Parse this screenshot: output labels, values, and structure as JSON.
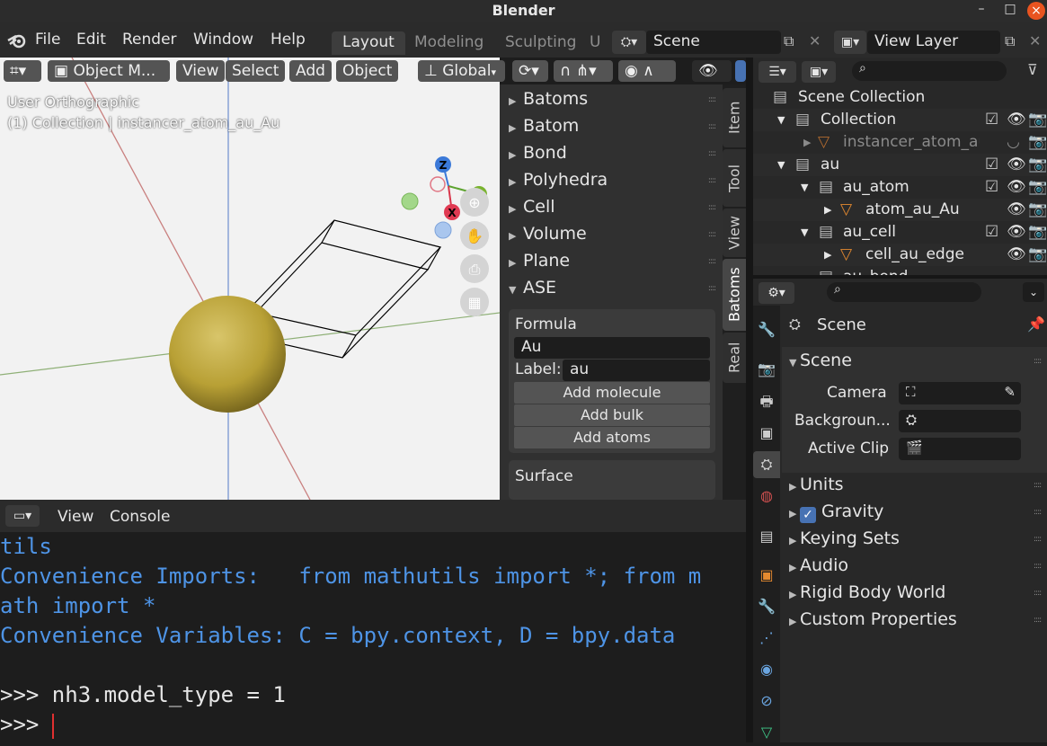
{
  "window": {
    "title": "Blender",
    "minimize": "–",
    "maximize": "□",
    "close": "×"
  },
  "menu": {
    "items": [
      "File",
      "Edit",
      "Render",
      "Window",
      "Help"
    ]
  },
  "workspaces": {
    "tabs": [
      "Layout",
      "Modeling",
      "Sculpting",
      "U"
    ],
    "active": "Layout"
  },
  "scene_selector": {
    "value": "Scene"
  },
  "view_layer_selector": {
    "value": "View Layer"
  },
  "viewport": {
    "mode": "Object M...",
    "menus": [
      "View",
      "Select",
      "Add",
      "Object"
    ],
    "orientation": "Global",
    "overlay_title": "User Orthographic",
    "overlay_subtitle": "(1) Collection | instancer_atom_au_Au",
    "gizmo_axes": [
      "Z",
      "Y",
      "X"
    ]
  },
  "npanel": {
    "panels": [
      "Batoms",
      "Batom",
      "Bond",
      "Polyhedra",
      "Cell",
      "Volume",
      "Plane",
      "ASE"
    ],
    "formula_label": "Formula",
    "formula_value": "Au",
    "label_label": "Label:",
    "label_value": "au",
    "buttons": [
      "Add molecule",
      "Add bulk",
      "Add atoms"
    ],
    "surface_label": "Surface",
    "tabs": [
      "Item",
      "Tool",
      "View",
      "Batoms",
      "Real"
    ],
    "active_tab": "Batoms"
  },
  "console": {
    "menus": [
      "View",
      "Console"
    ],
    "lines": [
      "tils",
      "Convenience Imports:   from mathutils import *; from m",
      "ath import *",
      "Convenience Variables: C = bpy.context, D = bpy.data",
      "",
      ">>> nh3.model_type = 1",
      ">>> "
    ]
  },
  "outliner": {
    "rows": [
      {
        "label": "Scene Collection",
        "indent": 0
      },
      {
        "label": "Collection",
        "indent": 1
      },
      {
        "label": "instancer_atom_au",
        "indent": 2
      },
      {
        "label": "au",
        "indent": 1
      },
      {
        "label": "au_atom",
        "indent": 2
      },
      {
        "label": "atom_au_Au",
        "indent": 3
      },
      {
        "label": "au_cell",
        "indent": 2
      },
      {
        "label": "cell_au_edge",
        "indent": 3
      },
      {
        "label": "au_bond",
        "indent": 2
      }
    ]
  },
  "properties": {
    "breadcrumb": "Scene",
    "section": "Scene",
    "fields": [
      {
        "label": "Camera",
        "value": ""
      },
      {
        "label": "Backgroun...",
        "value": ""
      },
      {
        "label": "Active Clip",
        "value": ""
      }
    ],
    "subpanels": [
      "Units",
      "Gravity",
      "Keying Sets",
      "Audio",
      "Rigid Body World",
      "Custom Properties"
    ],
    "gravity_checked": true
  },
  "colors": {
    "accent": "#4772b3",
    "console_blue": "#4e94e6",
    "atom_gold": "#c9b24b"
  }
}
